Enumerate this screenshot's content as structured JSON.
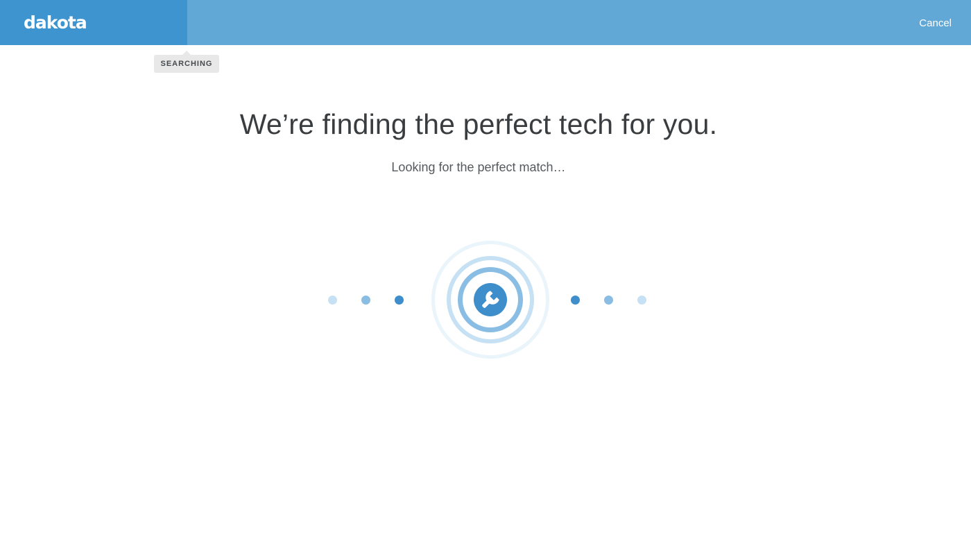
{
  "header": {
    "logo_text": "dakota",
    "cancel_label": "Cancel"
  },
  "status_badge": "SEARCHING",
  "main": {
    "title": "We’re finding the perfect tech for you.",
    "subtitle": "Looking for the perfect match…"
  },
  "colors": {
    "header_bg": "#61a8d6",
    "logo_bg": "#3d94cf",
    "accent": "#3d8ecb",
    "dot_light": "#c6e1f3",
    "dot_mid": "#89bde3",
    "dot_dark": "#3d8ecb"
  },
  "icons": {
    "center": "wrench-icon"
  }
}
